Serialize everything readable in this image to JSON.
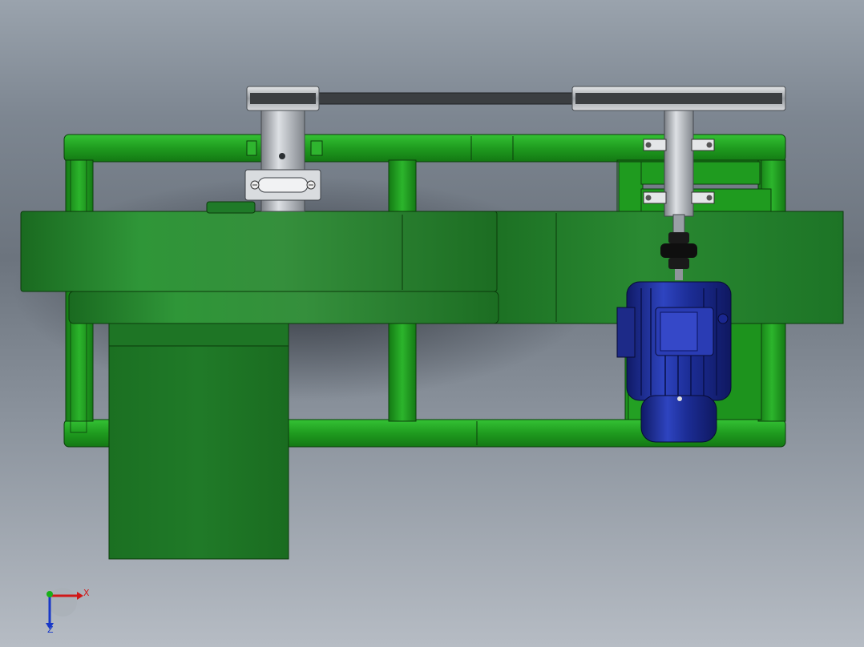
{
  "viewport": {
    "background": "#8b939d"
  },
  "colors": {
    "frame_green": "#1e9a1e",
    "frame_green_dark": "#137513",
    "housing_green": "#1f7a2a",
    "housing_green_light": "#2e8f38",
    "shaft_gray": "#b9bec4",
    "belt_dark": "#3a3d40",
    "motor_blue": "#1a2a8c",
    "motor_blue_light": "#3447c4",
    "coupling_black": "#141414",
    "axis_x": "#d01818",
    "axis_y": "#18b018",
    "axis_z": "#1838c8"
  },
  "axis_triad": {
    "x_label": "X",
    "z_label": "Z"
  }
}
